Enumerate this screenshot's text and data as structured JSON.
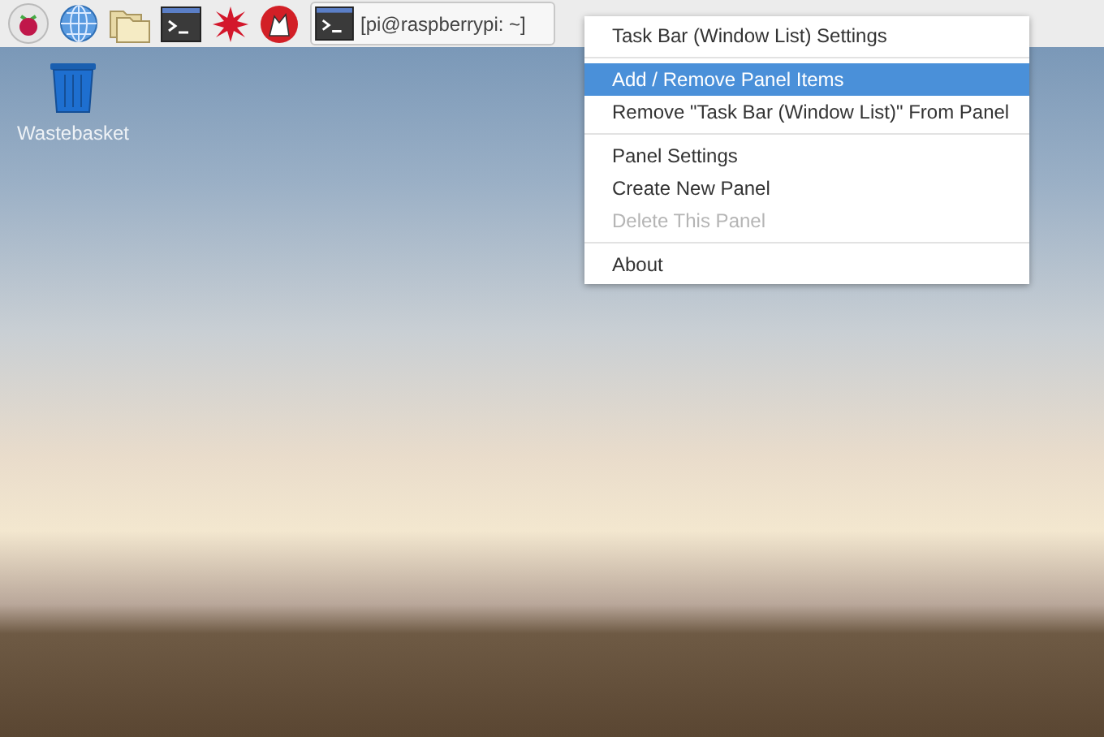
{
  "taskbar": {
    "window_button": {
      "title": "[pi@raspberrypi: ~]"
    }
  },
  "desktop_icons": [
    {
      "label": "Wastebasket"
    }
  ],
  "context_menu": {
    "sections": [
      [
        {
          "label": "Task Bar (Window List) Settings",
          "selected": false,
          "disabled": false
        }
      ],
      [
        {
          "label": "Add / Remove Panel Items",
          "selected": true,
          "disabled": false
        },
        {
          "label": "Remove \"Task Bar (Window List)\" From Panel",
          "selected": false,
          "disabled": false
        }
      ],
      [
        {
          "label": "Panel Settings",
          "selected": false,
          "disabled": false
        },
        {
          "label": "Create New Panel",
          "selected": false,
          "disabled": false
        },
        {
          "label": "Delete This Panel",
          "selected": false,
          "disabled": true
        }
      ],
      [
        {
          "label": "About",
          "selected": false,
          "disabled": false
        }
      ]
    ]
  }
}
